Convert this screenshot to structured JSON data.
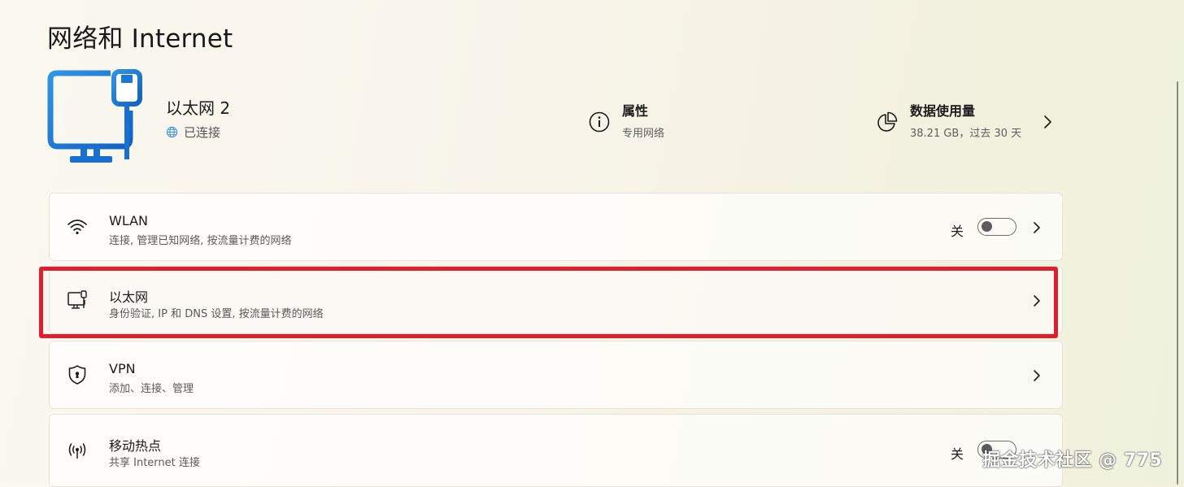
{
  "page": {
    "title": "网络和 Internet"
  },
  "connection": {
    "name": "以太网 2",
    "status": "已连接",
    "icon": "ethernet-computer-icon",
    "accent_color": "#1a78d2"
  },
  "properties": {
    "title": "属性",
    "subtitle": "专用网络",
    "icon": "info-icon"
  },
  "data_usage": {
    "title": "数据使用量",
    "subtitle": "38.21 GB，过去 30 天",
    "icon": "pie-chart-icon"
  },
  "settings": [
    {
      "title": "WLAN",
      "subtitle": "连接, 管理已知网络, 按流量计费的网络",
      "icon": "wifi-icon",
      "toggle_label": "关",
      "toggle_on": false
    },
    {
      "title": "以太网",
      "subtitle": "身份验证, IP 和 DNS 设置, 按流量计费的网络",
      "icon": "ethernet-icon",
      "highlighted": true,
      "highlight_color": "#e11f2c"
    },
    {
      "title": "VPN",
      "subtitle": "添加、连接、管理",
      "icon": "shield-icon"
    },
    {
      "title": "移动热点",
      "subtitle": "共享 Internet 连接",
      "icon": "hotspot-icon",
      "toggle_label": "关",
      "toggle_on": false
    }
  ],
  "watermark": {
    "text": "掘金技术社区 @ 775"
  }
}
